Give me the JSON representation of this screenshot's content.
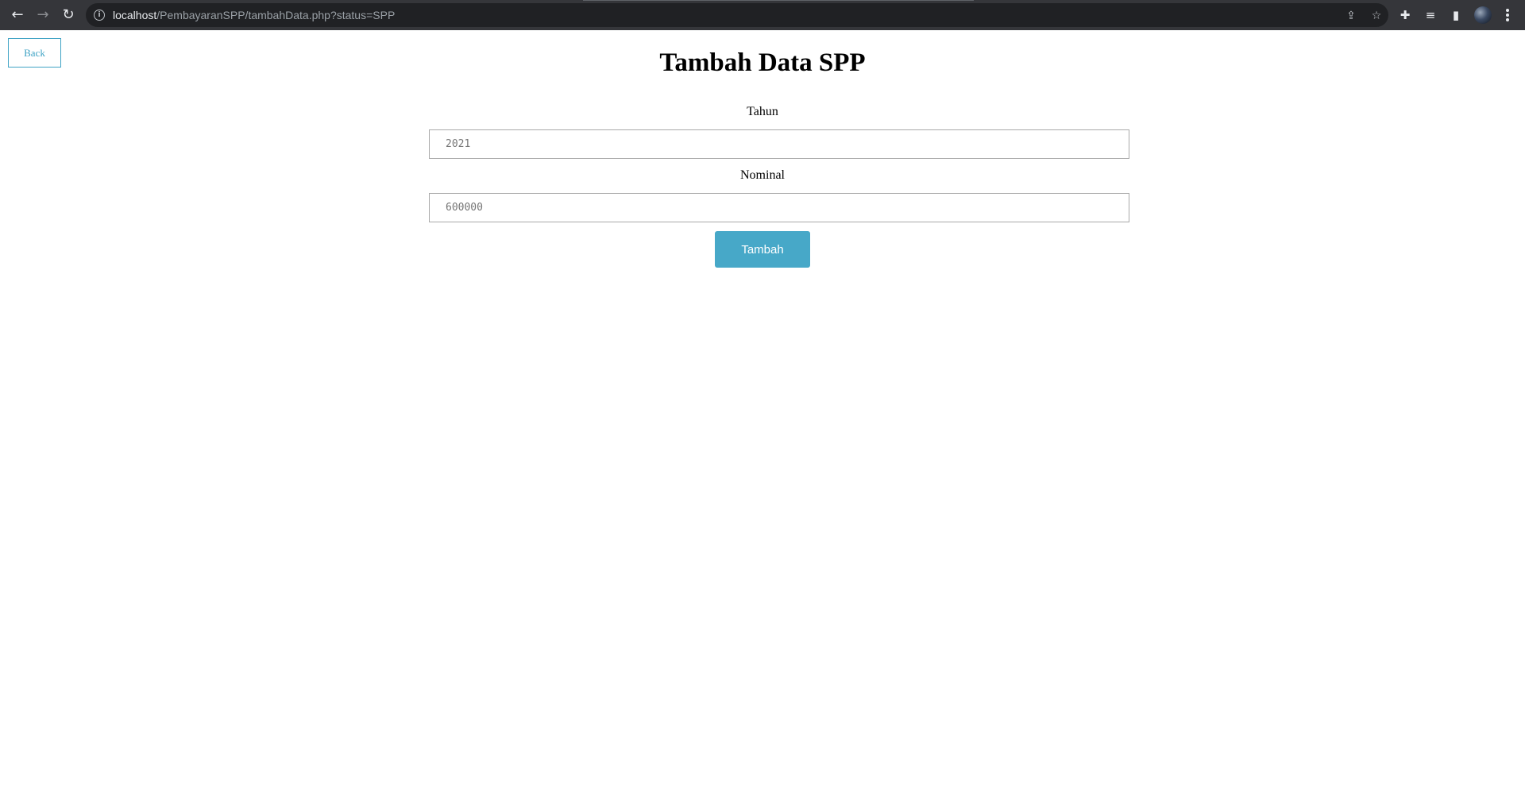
{
  "browser": {
    "url_host": "localhost",
    "url_path": "/PembayaranSPP/tambahData.php?status=SPP",
    "icons": {
      "back": "back-arrow-icon",
      "forward": "forward-arrow-icon",
      "reload": "reload-icon",
      "info": "info-icon",
      "share": "share-icon",
      "bookmark": "star-icon",
      "extensions": "puzzle-icon",
      "media": "media-queue-icon",
      "side_panel": "side-panel-icon",
      "profile": "avatar",
      "menu": "kebab-menu-icon"
    }
  },
  "page": {
    "back_label": "Back",
    "title": "Tambah Data SPP",
    "form": {
      "tahun_label": "Tahun",
      "tahun_placeholder": "2021",
      "nominal_label": "Nominal",
      "nominal_placeholder": "600000",
      "submit_label": "Tambah"
    }
  },
  "colors": {
    "accent": "#47a8c8",
    "back_border": "#3fa3c5",
    "chrome": "#35363a"
  }
}
